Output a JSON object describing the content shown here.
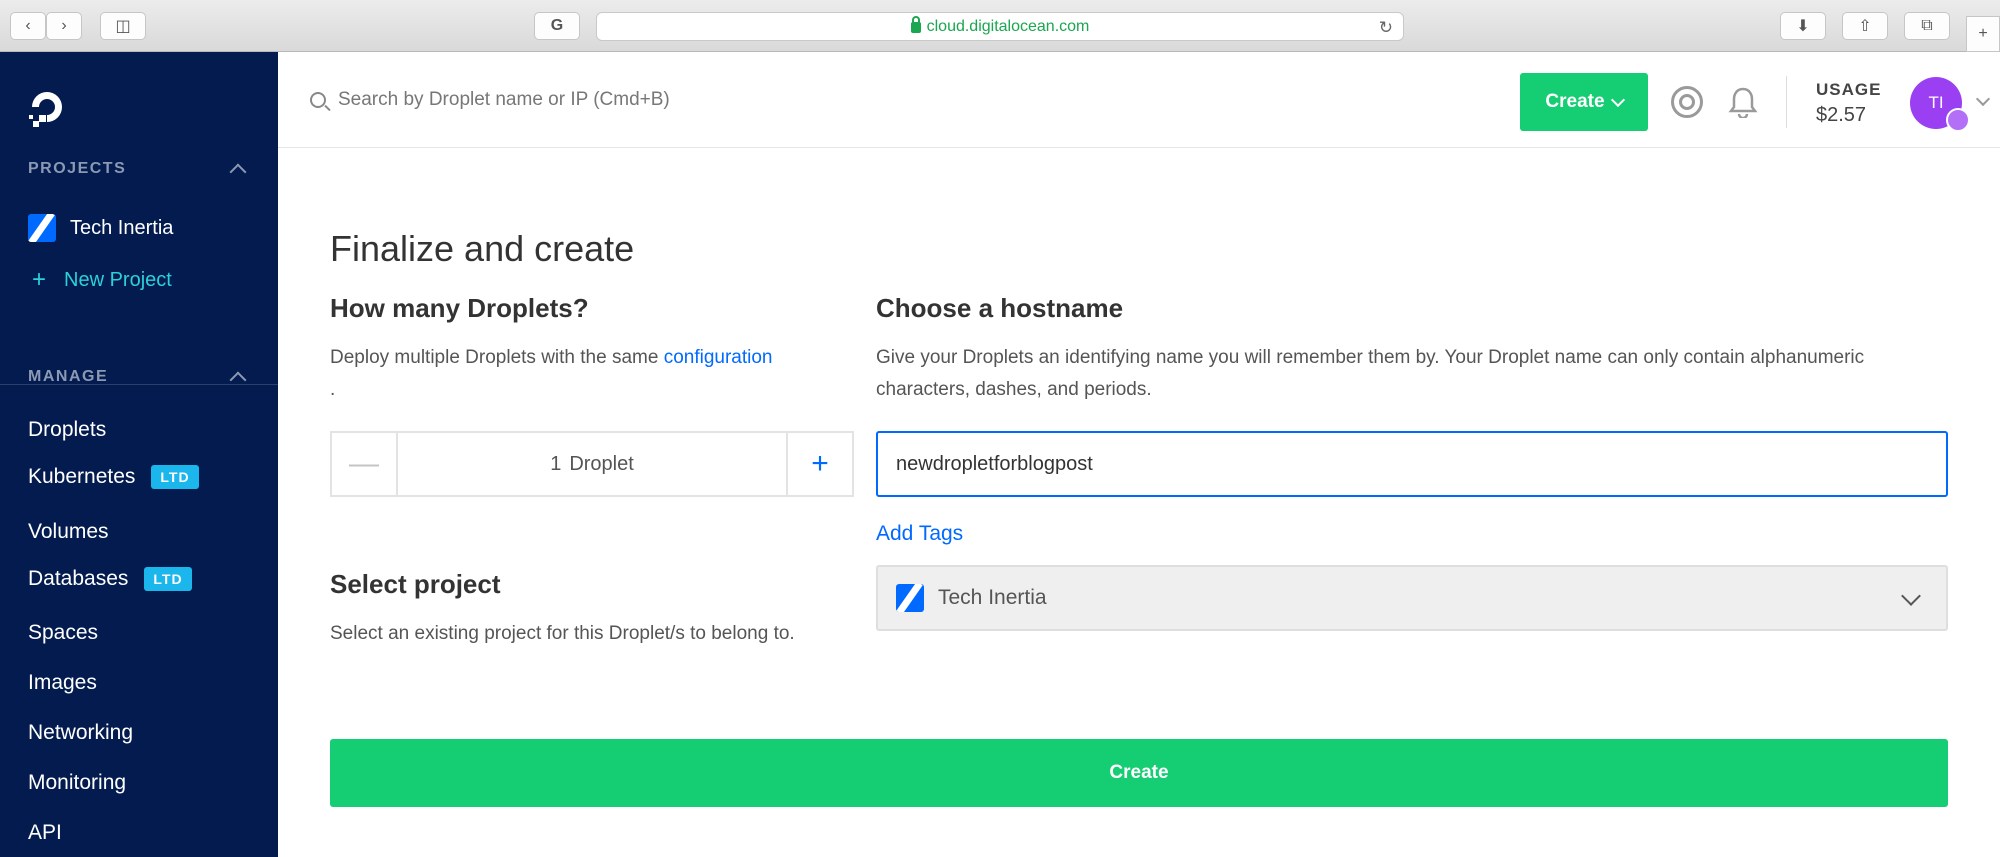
{
  "browser": {
    "url": "cloud.digitalocean.com"
  },
  "sidebar": {
    "projects_title": "PROJECTS",
    "project_name": "Tech Inertia",
    "new_project": "New Project",
    "manage_title": "MANAGE",
    "items": [
      {
        "label": "Droplets",
        "badge": ""
      },
      {
        "label": "Kubernetes",
        "badge": "LTD"
      },
      {
        "label": "Volumes",
        "badge": ""
      },
      {
        "label": "Databases",
        "badge": "LTD"
      },
      {
        "label": "Spaces",
        "badge": ""
      },
      {
        "label": "Images",
        "badge": ""
      },
      {
        "label": "Networking",
        "badge": ""
      },
      {
        "label": "Monitoring",
        "badge": ""
      },
      {
        "label": "API",
        "badge": ""
      }
    ]
  },
  "topbar": {
    "search_placeholder": "Search by Droplet name or IP (Cmd+B)",
    "create_label": "Create",
    "usage_label": "USAGE",
    "usage_value": "$2.57",
    "avatar_initials": "TI"
  },
  "main": {
    "title": "Finalize and create",
    "droplets": {
      "heading": "How many Droplets?",
      "desc_prefix": "Deploy multiple Droplets with the same ",
      "desc_link": "configuration",
      "desc_suffix": ".",
      "minus": "—",
      "plus": "+",
      "count": "1",
      "unit": "Droplet"
    },
    "hostname": {
      "heading": "Choose a hostname",
      "desc": "Give your Droplets an identifying name you will remember them by. Your Droplet name can only contain alphanumeric characters, dashes, and periods.",
      "value": "newdropletforblogpost",
      "add_tags": "Add Tags"
    },
    "project": {
      "heading": "Select project",
      "desc": "Select an existing project for this Droplet/s to belong to.",
      "selected": "Tech Inertia"
    },
    "create_button": "Create"
  },
  "colors": {
    "sidebar_bg": "#031b4e",
    "accent_green": "#15cd72",
    "link_blue": "#0069ff",
    "badge_blue": "#1bb6ec",
    "avatar_purple": "#9b3ff2"
  }
}
